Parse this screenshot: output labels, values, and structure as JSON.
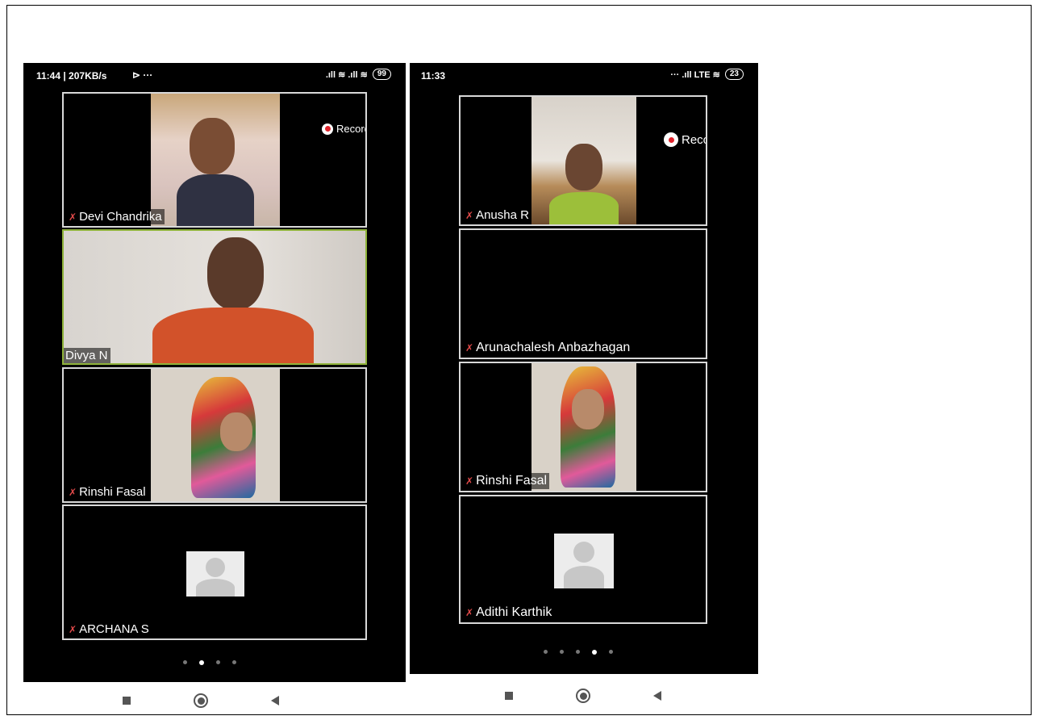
{
  "left_phone": {
    "status": {
      "time_info": "11:44 | 207KB/s",
      "extra_icons": "⊳  ···",
      "signal": ".ıll ≋ .ıll ≋",
      "battery": "99"
    },
    "recording_label": "Recording",
    "tiles": [
      {
        "name": "Devi Chandrika"
      },
      {
        "name": "Divya N"
      },
      {
        "name": "Rinshi Fasal"
      },
      {
        "name": "ARCHANA S"
      }
    ],
    "page_dots": 4,
    "active_dot": 1
  },
  "right_phone": {
    "status": {
      "time": "11:33",
      "signal": "··· .ıll LTE ≋",
      "battery": "23"
    },
    "recording_label": "Recording",
    "tiles": [
      {
        "name": "Anusha R"
      },
      {
        "name": "Arunachalesh Anbazhagan"
      },
      {
        "name": "Rinshi Fasal"
      },
      {
        "name": "Adithi Karthik"
      }
    ],
    "page_dots": 5,
    "active_dot": 3
  },
  "icons": {
    "mic": "muted-mic-icon",
    "nav": [
      "recent-apps-icon",
      "home-icon",
      "back-icon"
    ]
  },
  "colors": {
    "active_speaker_border": "#8fb33a",
    "recording_dot": "#e0232b",
    "muted_mic": "#e34a4a"
  }
}
